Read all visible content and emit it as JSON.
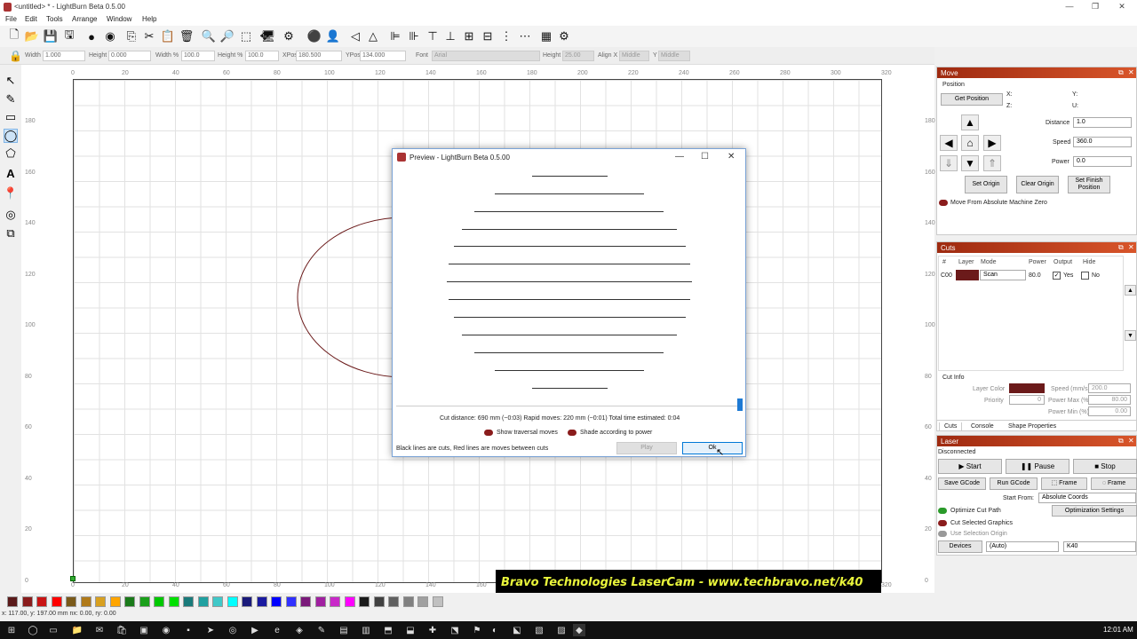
{
  "window": {
    "title": "<untitled> * - LightBurn Beta 0.5.00",
    "controls": [
      "—",
      "❐",
      "✕"
    ]
  },
  "menu": [
    "File",
    "Edit",
    "Tools",
    "Arrange",
    "Window",
    "Help"
  ],
  "toolbar_icons": [
    "new-icon",
    "open-icon",
    "save-icon",
    "save-as-icon",
    "import-icon",
    "export-icon",
    "copy-icon",
    "cut-icon",
    "paste-icon",
    "delete-icon",
    "zoom-in-icon",
    "zoom-out-icon",
    "zoom-frame-icon",
    "move-icon",
    "monitor-icon",
    "settings-icon",
    "group-icon",
    "ungroup-icon",
    "mirror-h-icon",
    "mirror-v-icon",
    "align-left-icon",
    "align-right-icon",
    "align-top-icon",
    "align-bottom-icon",
    "align-center-h-icon",
    "align-center-v-icon",
    "distribute-h-icon",
    "distribute-v-icon",
    "array-icon",
    "circular-array-icon"
  ],
  "props": {
    "width_label": "Width",
    "width_val": "1.000",
    "height_label": "Height",
    "height_val": "0.000",
    "widthpct_label": "Width %",
    "widthpct_val": "100.0",
    "heightpct_label": "Height %",
    "heightpct_val": "100.0",
    "xpos_label": "XPos",
    "xpos_val": "180.500",
    "ypos_label": "YPos",
    "ypos_val": "134.000",
    "font_label": "Font",
    "font_val": "Arial",
    "fheight_label": "Height",
    "fheight_val": "25.00",
    "alignx_label": "Align X",
    "alignx_val": "Middle",
    "y_label": "Y",
    "y_val": "Middle"
  },
  "ruler": {
    "top": [
      "0",
      "20",
      "40",
      "60",
      "80",
      "100",
      "120",
      "140",
      "160",
      "180",
      "200",
      "220",
      "240",
      "260",
      "280",
      "300",
      "320"
    ],
    "bottom": [
      "0",
      "20",
      "40",
      "60",
      "80",
      "100",
      "120",
      "140",
      "160",
      "180",
      "200",
      "220",
      "240",
      "260",
      "280",
      "300",
      "320"
    ],
    "left": [
      "180",
      "160",
      "140",
      "120",
      "100",
      "80",
      "60",
      "40",
      "20",
      "0"
    ],
    "right": [
      "180",
      "160",
      "140",
      "120",
      "100",
      "80",
      "60",
      "40",
      "20",
      "0"
    ]
  },
  "dialog": {
    "title": "Preview - LightBurn Beta 0.5.00",
    "stats": "Cut distance: 690 mm (~0:03)   Rapid moves: 220 mm (~0:01)   Total time estimated: 0:04",
    "show_traversal": "Show traversal moves",
    "shade_power": "Shade according to power",
    "footer_note": "Black lines are cuts, Red lines are moves between cuts",
    "play": "Play",
    "ok": "Ok"
  },
  "move_panel": {
    "title": "Move",
    "position_label": "Position",
    "get_position": "Get Position",
    "x_label": "X:",
    "y_label": "Y:",
    "z_label": "Z:",
    "u_label": "U:",
    "distance_label": "Distance",
    "distance_val": "1.0",
    "speed_label": "Speed",
    "speed_val": "360.0",
    "power_label": "Power",
    "power_val": "0.0",
    "set_origin": "Set Origin",
    "clear_origin": "Clear Origin",
    "set_finish": "Set Finish Position",
    "abs_machine": "Move From Absolute Machine Zero"
  },
  "cuts_panel": {
    "title": "Cuts",
    "headers": [
      "#",
      "Layer",
      "Mode",
      "Power",
      "Output",
      "Hide"
    ],
    "row": {
      "num": "C00",
      "mode": "Scan",
      "power": "80.0",
      "output": "Yes",
      "hide": "No"
    },
    "cut_info": "Cut Info",
    "layer_color": "Layer Color",
    "speed_label": "Speed (mm/s)",
    "speed_val": "200.0",
    "priority_label": "Priority",
    "priority_val": "0",
    "power_max_label": "Power Max (%)",
    "power_max_val": "80.00",
    "power_min_label": "Power Min (%)",
    "power_min_val": "0.00",
    "tabs": [
      "Cuts",
      "Console",
      "Shape Properties"
    ]
  },
  "laser_panel": {
    "title": "Laser",
    "status": "Disconnected",
    "start": "Start",
    "pause": "Pause",
    "stop": "Stop",
    "save_gcode": "Save GCode",
    "run_gcode": "Run GCode",
    "frame1": "Frame",
    "frame2": "Frame",
    "start_from_label": "Start From:",
    "start_from_val": "Absolute Coords",
    "optimize": "Optimize Cut Path",
    "opt_settings": "Optimization Settings",
    "cut_selected": "Cut Selected Graphics",
    "use_selection": "Use Selection Origin",
    "devices": "Devices",
    "device_port": "(Auto)",
    "device_model": "K40"
  },
  "status_text": "x: 117.00, y: 197.00 mm  nx: 0.00,  ry: 0.00",
  "banner": "Bravo Technologies LaserCam - www.techbravo.net/k40",
  "clock": "12:01 AM",
  "palette": [
    "#5a1a1a",
    "#8a1c1c",
    "#c81414",
    "#ff0000",
    "#7a5a1a",
    "#b07a1a",
    "#d8a020",
    "#ffa500",
    "#1a7a1a",
    "#1aa01a",
    "#00c800",
    "#00e000",
    "#1a7a7a",
    "#20a0a0",
    "#40c8c8",
    "#00ffff",
    "#1a1a7a",
    "#1a1aa0",
    "#0000ff",
    "#3030ff",
    "#7a1a7a",
    "#a020a0",
    "#c828c8",
    "#ff00ff",
    "#1a1a1a",
    "#404040",
    "#606060",
    "#808080",
    "#a0a0a0",
    "#c0c0c0"
  ],
  "colors": {
    "layer": "#6b1a1a",
    "accent": "#1e7ad4",
    "panel_head": "#c4461f"
  }
}
